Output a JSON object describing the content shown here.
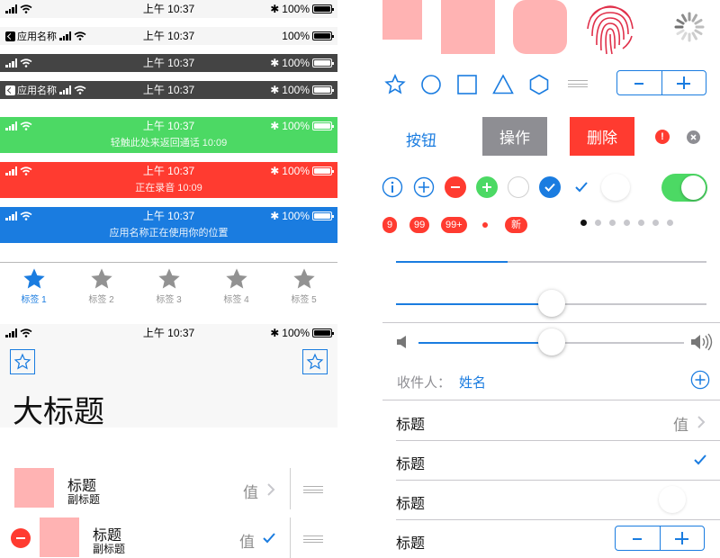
{
  "colors": {
    "accent": "#1a7ce0",
    "danger": "#ff3b30",
    "success": "#4cd964",
    "pink": "#ffb3b3",
    "gray_button": "#8e8e93"
  },
  "status_bars": [
    {
      "time": "上午 10:37",
      "battery": "100%",
      "back_app": ""
    },
    {
      "time": "上午 10:37",
      "battery": "100%",
      "back_app": "应用名称"
    },
    {
      "time": "上午 10:37",
      "battery": "100%",
      "back_app": ""
    },
    {
      "time": "上午 10:37",
      "battery": "100%",
      "back_app": "应用名称"
    }
  ],
  "call_banners": [
    {
      "time": "上午 10:37",
      "battery": "100%",
      "message": "轻触此处来返回通话 10:09",
      "color": "#4cd964"
    },
    {
      "time": "上午 10:37",
      "battery": "100%",
      "message": "正在录音 10:09",
      "color": "#ff3b30"
    },
    {
      "time": "上午 10:37",
      "battery": "100%",
      "message": "应用名称正在使用你的位置",
      "color": "#1a7ce0"
    }
  ],
  "tab_bar": {
    "items": [
      "标签 1",
      "标签 2",
      "标签 3",
      "标签 4",
      "标签 5"
    ],
    "active_index": 0
  },
  "large_nav": {
    "time": "上午 10:37",
    "battery": "100%",
    "title": "大标题"
  },
  "list_cells": [
    {
      "title": "标题",
      "subtitle": "副标题",
      "value": "值",
      "accessory": "chevron"
    },
    {
      "title": "标题",
      "subtitle": "副标题",
      "value": "值",
      "accessory": "checkmark"
    }
  ],
  "buttons": {
    "text_button": "按钮",
    "action_button": "操作",
    "delete_button": "删除"
  },
  "badges": [
    "9",
    "99",
    "99+",
    "",
    "新"
  ],
  "page_control": {
    "count": 7,
    "current": 0
  },
  "progress": {
    "value": 0.36
  },
  "slider": {
    "value": 0.5
  },
  "volume_slider": {
    "value": 0.5
  },
  "mail_field": {
    "label": "收件人：",
    "value": "姓名"
  },
  "settings_rows": [
    {
      "label": "标题",
      "value": "值",
      "accessory": "chevron"
    },
    {
      "label": "标题",
      "value": "",
      "accessory": "checkmark"
    },
    {
      "label": "标题",
      "value": "",
      "accessory": "switch-off"
    },
    {
      "label": "标题",
      "value": "",
      "accessory": "stepper"
    }
  ],
  "toggle": {
    "on": true
  }
}
